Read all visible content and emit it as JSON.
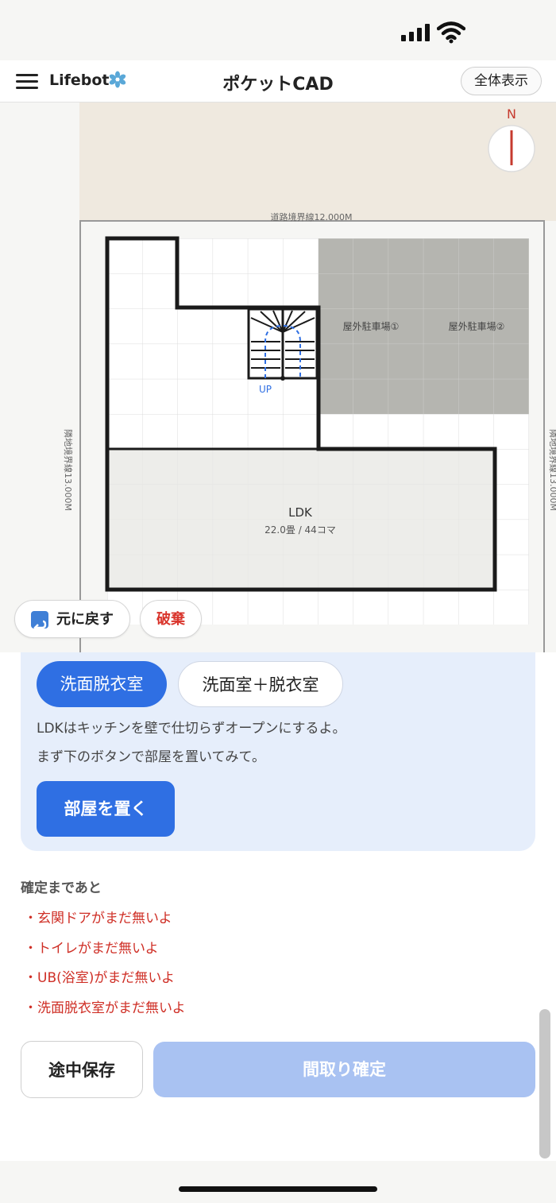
{
  "app": {
    "brand": "Lifebot",
    "title": "ポケットCAD",
    "fit_button": "全体表示"
  },
  "plan": {
    "compass": "N",
    "road_boundary": "道路境界線12.000M",
    "left_boundary": "隣地境界線13.000M",
    "right_boundary": "隣地境界線13.000M",
    "parking1": "屋外駐車場①",
    "parking2": "屋外駐車場②",
    "stairs_label": "UP",
    "room_name": "LDK",
    "room_size": "22.0畳 / 44コマ",
    "undo_label": "元に戻す",
    "discard_label": "破棄"
  },
  "panel": {
    "options": [
      "洗面脱衣室",
      "洗面室＋脱衣室"
    ],
    "selected": "洗面脱衣室",
    "message1": "LDKはキッチンを壁で仕切らずオープンにするよ。",
    "message2": "まず下のボタンで部屋を置いてみて。",
    "place_button": "部屋を置く"
  },
  "todo": {
    "title": "確定まであと",
    "items": [
      "・玄関ドアがまだ無いよ",
      "・トイレがまだ無いよ",
      "・UB(浴室)がまだ無いよ",
      "・洗面脱衣室がまだ無いよ"
    ]
  },
  "footer": {
    "save_button": "途中保存",
    "confirm_button": "間取り確定"
  },
  "colors": {
    "accent": "#2f6fe3",
    "warning": "#cf2f26",
    "disabled": "#a9c2f2",
    "road": "#efe9df",
    "parking": "#b5b5b0",
    "room": "#ededea"
  }
}
